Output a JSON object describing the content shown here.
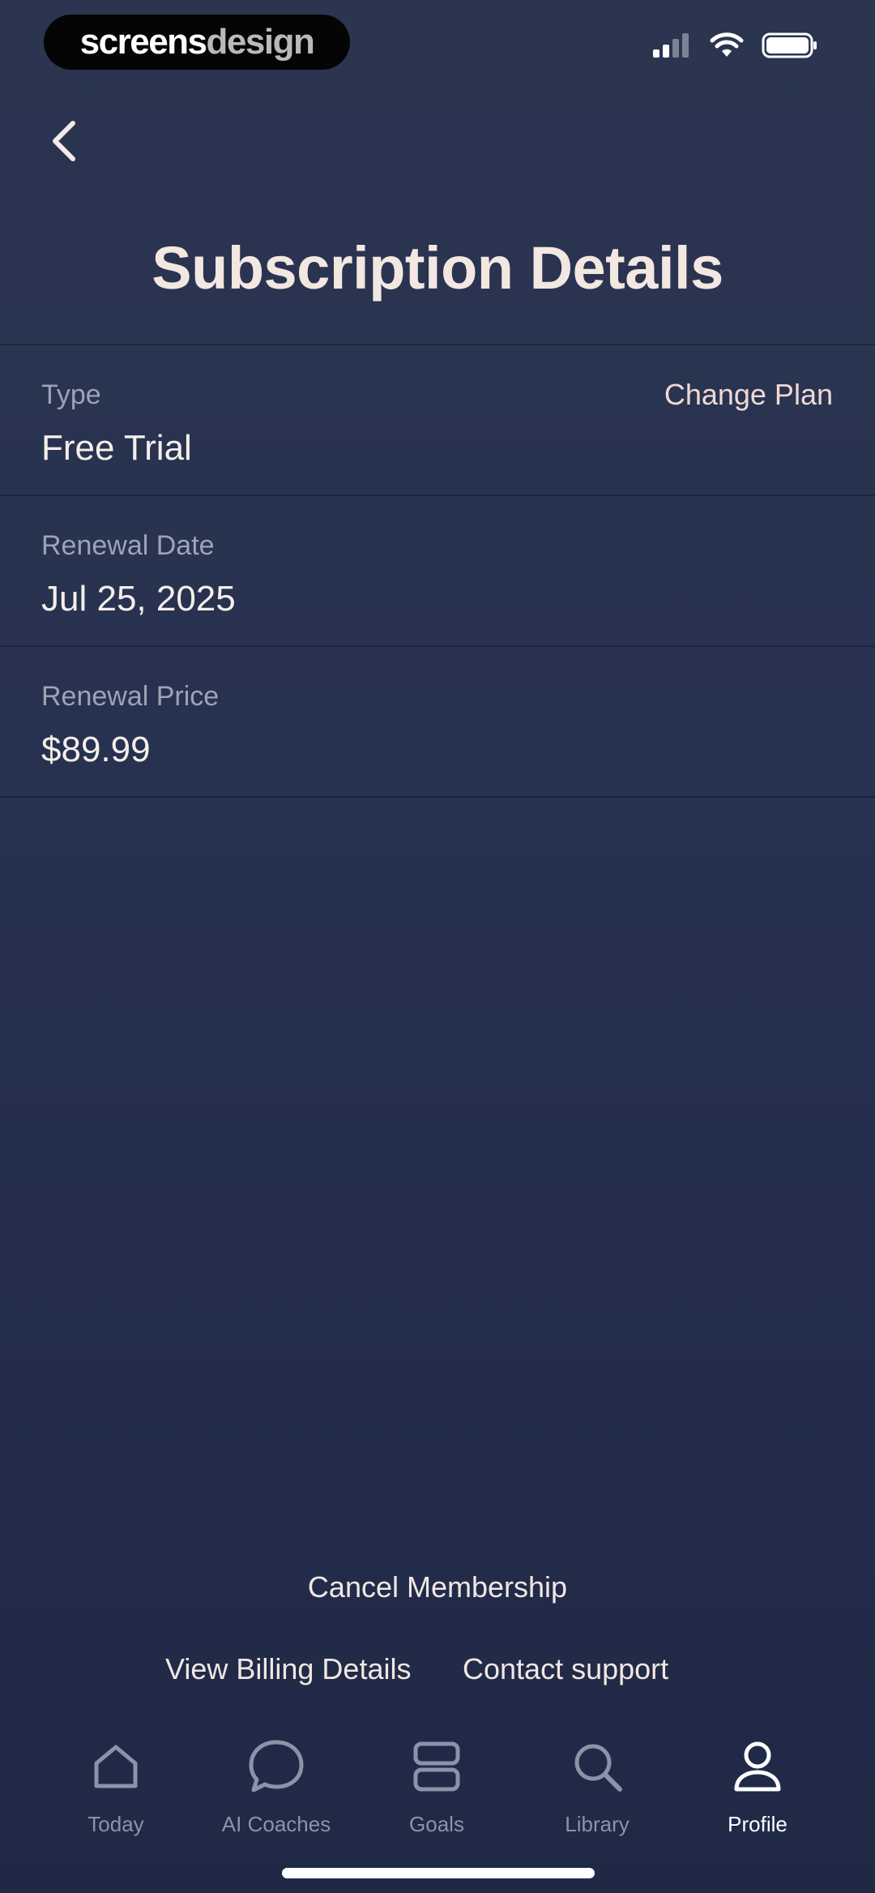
{
  "brand": {
    "part1": "screens",
    "part2": "design"
  },
  "header": {
    "title": "Subscription Details"
  },
  "subscription": {
    "type_label": "Type",
    "type_value": "Free Trial",
    "change_plan": "Change Plan",
    "renewal_date_label": "Renewal Date",
    "renewal_date_value": "Jul 25, 2025",
    "renewal_price_label": "Renewal Price",
    "renewal_price_value": "$89.99"
  },
  "actions": {
    "cancel": "Cancel Membership",
    "billing": "View Billing Details",
    "support": "Contact support"
  },
  "tabs": [
    {
      "label": "Today",
      "icon": "home-icon",
      "active": false
    },
    {
      "label": "AI Coaches",
      "icon": "chat-bubble-icon",
      "active": false
    },
    {
      "label": "Goals",
      "icon": "stacked-rectangles-icon",
      "active": false
    },
    {
      "label": "Library",
      "icon": "search-icon",
      "active": false
    },
    {
      "label": "Profile",
      "icon": "person-icon",
      "active": true
    }
  ],
  "colors": {
    "background": "#273250",
    "accent_text": "#efd9d2",
    "muted_text": "#9ea3b4",
    "inactive_tab": "#8c93a8"
  }
}
